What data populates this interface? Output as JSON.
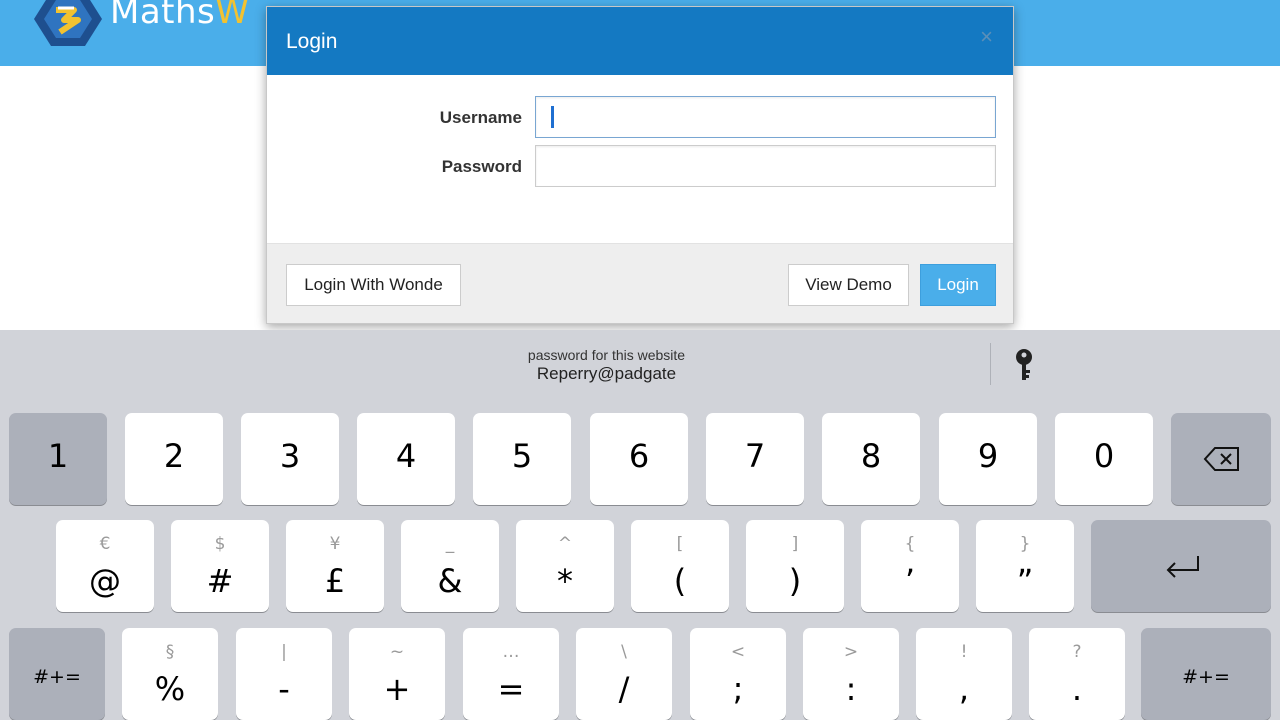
{
  "brand": {
    "part1": "Maths",
    "part2": "W"
  },
  "modal": {
    "title": "Login",
    "close": "×",
    "username_label": "Username",
    "password_label": "Password",
    "username_value": "",
    "password_value": "",
    "buttons": {
      "wonde": "Login With Wonde",
      "demo": "View Demo",
      "login": "Login"
    }
  },
  "keyboard": {
    "suggestion_caption": "password for this website",
    "suggestion_value": "Reperry@padgate",
    "row1": [
      "1",
      "2",
      "3",
      "4",
      "5",
      "6",
      "7",
      "8",
      "9",
      "0"
    ],
    "row2": [
      {
        "main": "@",
        "alt": "€"
      },
      {
        "main": "#",
        "alt": "$"
      },
      {
        "main": "£",
        "alt": "¥"
      },
      {
        "main": "&",
        "alt": "_"
      },
      {
        "main": "*",
        "alt": "^"
      },
      {
        "main": "(",
        "alt": "["
      },
      {
        "main": ")",
        "alt": "]"
      },
      {
        "main": "’",
        "alt": "{"
      },
      {
        "main": "”",
        "alt": "}"
      }
    ],
    "row3": [
      {
        "main": "%",
        "alt": "§"
      },
      {
        "main": "-",
        "alt": "|"
      },
      {
        "main": "+",
        "alt": "~"
      },
      {
        "main": "=",
        "alt": "…"
      },
      {
        "main": "/",
        "alt": "\\"
      },
      {
        "main": ";",
        "alt": "<"
      },
      {
        "main": ":",
        "alt": ">"
      },
      {
        "main": ",",
        "alt": "!"
      },
      {
        "main": ".",
        "alt": "?"
      }
    ],
    "symbols_key": "#+=",
    "backspace_icon": "backspace-icon",
    "return_icon": "return-icon",
    "key_icon": "key-icon"
  },
  "colors": {
    "topbar": "#4aaeea",
    "modal_header": "#1479c2",
    "login_button": "#4aaeea",
    "keyboard_bg": "#d1d3d9"
  }
}
